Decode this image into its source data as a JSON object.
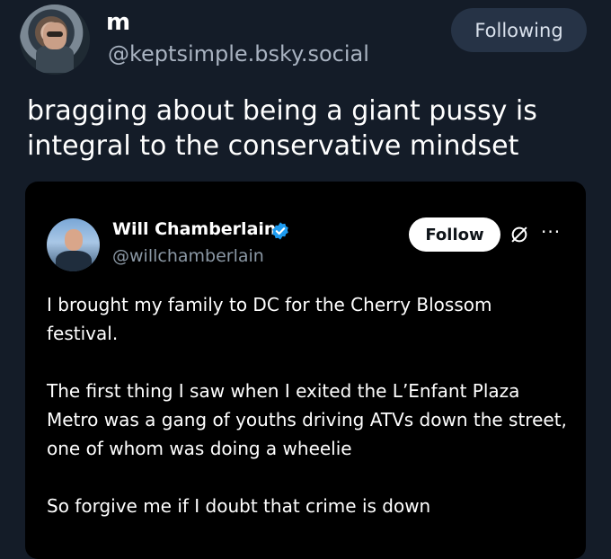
{
  "post": {
    "author_name": "m",
    "author_handle": "@keptsimple.bsky.social",
    "follow_state": "Following",
    "text": "bragging about being a giant pussy is integral to the conservative mindset"
  },
  "quoted": {
    "author_name": "Will Chamberlain",
    "author_handle": "@willchamberlain",
    "follow_label": "Follow",
    "more_label": "···",
    "paragraphs": [
      "I brought my family to DC for the Cherry Blossom festival.",
      "The first thing I saw when I exited the L’Enfant Plaza Metro was a gang of youths driving ATVs down the street, one of whom was doing a wheelie",
      "So forgive me if I doubt that crime is down"
    ]
  },
  "colors": {
    "background": "#141c28",
    "following_button": "#263346",
    "verified_blue": "#1d9bf0",
    "handle_gray": "#a9b3c1"
  },
  "icons": [
    "verified-badge-icon",
    "grok-icon",
    "more-icon"
  ]
}
